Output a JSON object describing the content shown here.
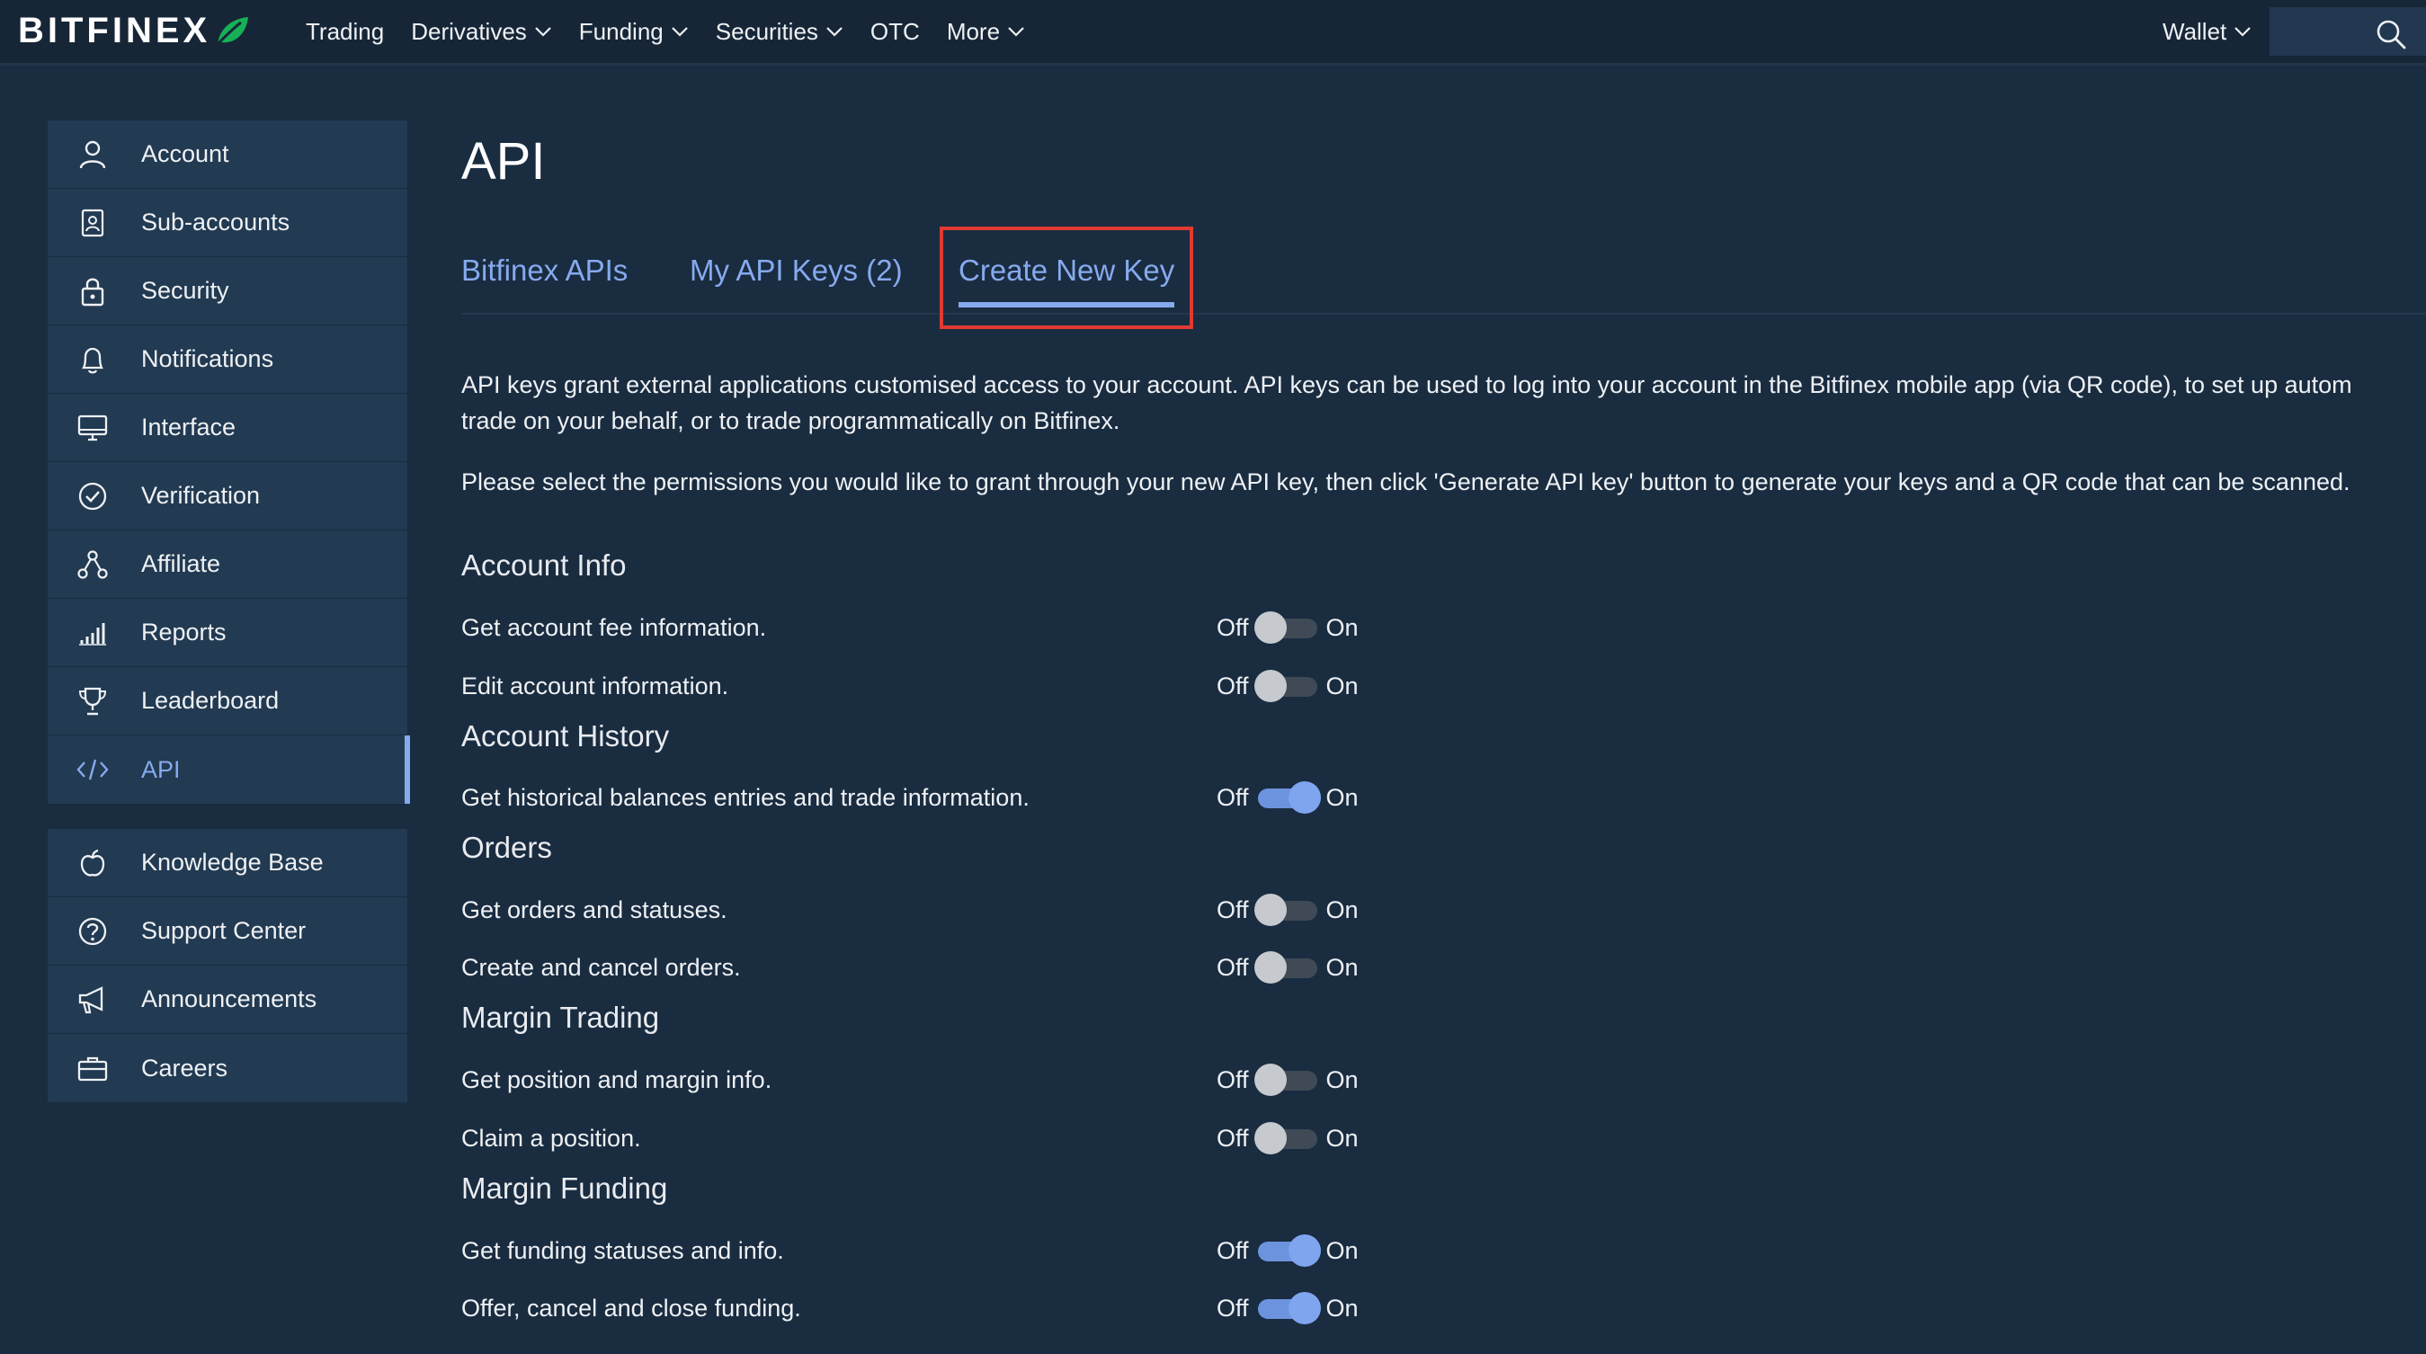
{
  "header": {
    "logo_text": "BITFINEX",
    "nav": [
      {
        "label": "Trading",
        "has_dropdown": false
      },
      {
        "label": "Derivatives",
        "has_dropdown": true
      },
      {
        "label": "Funding",
        "has_dropdown": true
      },
      {
        "label": "Securities",
        "has_dropdown": true
      },
      {
        "label": "OTC",
        "has_dropdown": false
      },
      {
        "label": "More",
        "has_dropdown": true
      }
    ],
    "wallet_label": "Wallet"
  },
  "sidebar": {
    "groups": [
      [
        {
          "label": "Account",
          "icon": "user-icon"
        },
        {
          "label": "Sub-accounts",
          "icon": "sub-accounts-icon"
        },
        {
          "label": "Security",
          "icon": "lock-icon"
        },
        {
          "label": "Notifications",
          "icon": "bell-icon"
        },
        {
          "label": "Interface",
          "icon": "monitor-icon"
        },
        {
          "label": "Verification",
          "icon": "check-circle-icon"
        },
        {
          "label": "Affiliate",
          "icon": "affiliate-network-icon"
        },
        {
          "label": "Reports",
          "icon": "bar-chart-icon"
        },
        {
          "label": "Leaderboard",
          "icon": "trophy-icon"
        },
        {
          "label": "API",
          "icon": "code-icon",
          "active": true
        }
      ],
      [
        {
          "label": "Knowledge Base",
          "icon": "apple-icon"
        },
        {
          "label": "Support Center",
          "icon": "question-circle-icon"
        },
        {
          "label": "Announcements",
          "icon": "megaphone-icon"
        },
        {
          "label": "Careers",
          "icon": "briefcase-icon"
        }
      ]
    ]
  },
  "main": {
    "title": "API",
    "tabs": [
      {
        "label": "Bitfinex APIs",
        "active": false
      },
      {
        "label": "My API Keys (2)",
        "active": false
      },
      {
        "label": "Create New Key",
        "active": true
      }
    ],
    "description_1": "API keys grant external applications customised access to your account. API keys can be used to log into your account in the Bitfinex mobile app (via QR code), to set up autom",
    "description_1b": "trade on your behalf, or to trade programmatically on Bitfinex.",
    "description_2": "Please select the permissions you would like to grant through your new API key, then click 'Generate API key' button to generate your keys and a QR code that can be scanned.",
    "toggle_off_label": "Off",
    "toggle_on_label": "On",
    "sections": [
      {
        "title": "Account Info",
        "permissions": [
          {
            "label": "Get account fee information.",
            "enabled": false
          },
          {
            "label": "Edit account information.",
            "enabled": false
          }
        ]
      },
      {
        "title": "Account History",
        "permissions": [
          {
            "label": "Get historical balances entries and trade information.",
            "enabled": true
          }
        ]
      },
      {
        "title": "Orders",
        "permissions": [
          {
            "label": "Get orders and statuses.",
            "enabled": false
          },
          {
            "label": "Create and cancel orders.",
            "enabled": false
          }
        ]
      },
      {
        "title": "Margin Trading",
        "permissions": [
          {
            "label": "Get position and margin info.",
            "enabled": false
          },
          {
            "label": "Claim a position.",
            "enabled": false
          }
        ]
      },
      {
        "title": "Margin Funding",
        "permissions": [
          {
            "label": "Get funding statuses and info.",
            "enabled": true
          },
          {
            "label": "Offer, cancel and close funding.",
            "enabled": true
          }
        ]
      }
    ]
  },
  "colors": {
    "background": "#1a2c40",
    "topbar": "#172637",
    "sidebar_item": "#223a52",
    "accent": "#86aaee",
    "toggle_on": "#7fa5ef",
    "toggle_off_knob": "#c6c9cd",
    "highlight_box": "#e03a32",
    "logo_leaf": "#16b157"
  }
}
